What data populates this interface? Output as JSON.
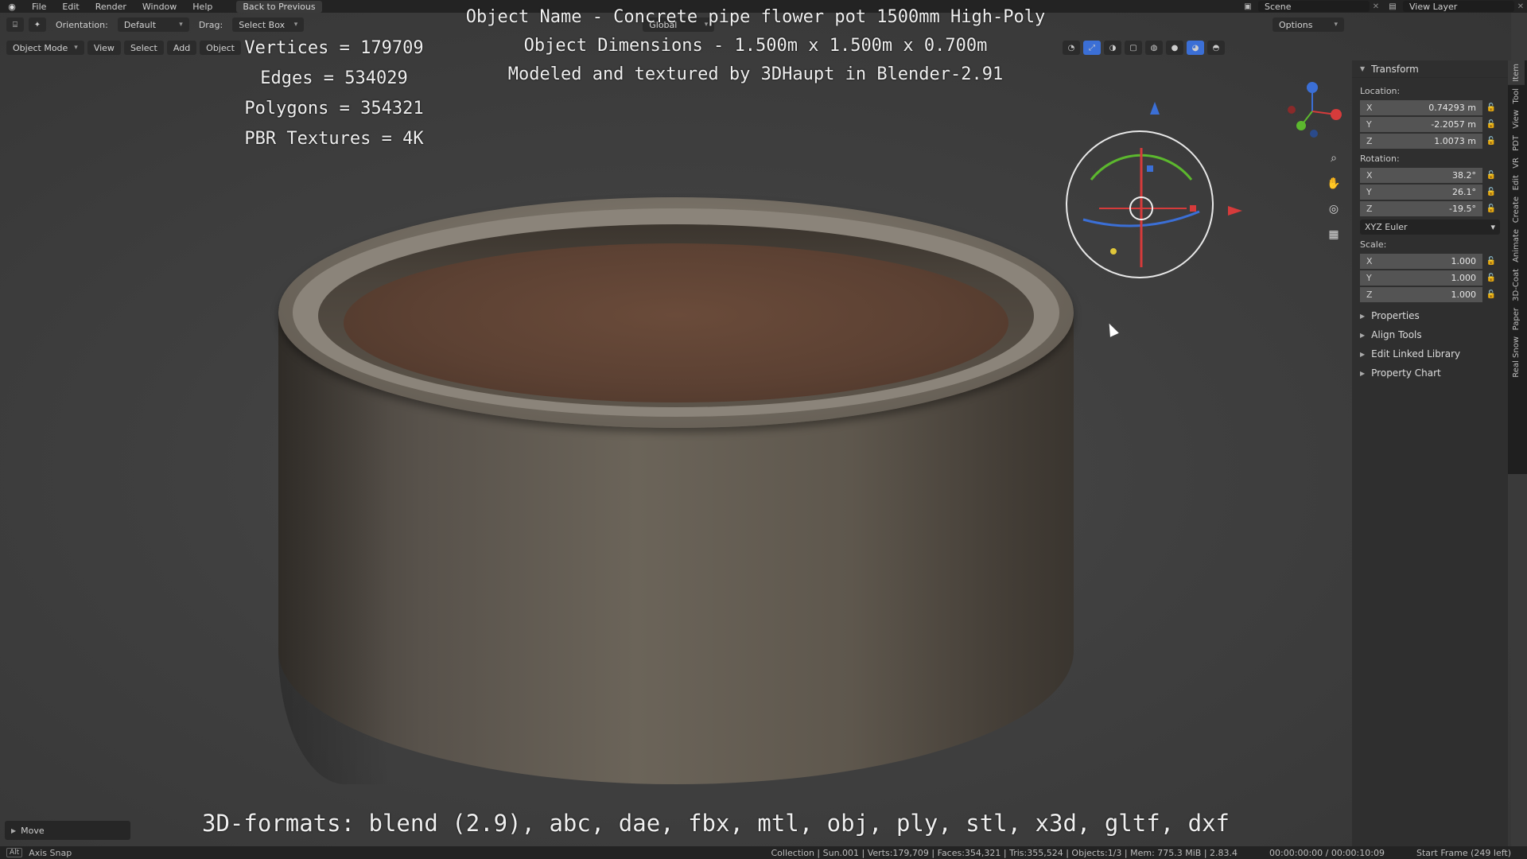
{
  "topbar": {
    "menus": [
      "File",
      "Edit",
      "Render",
      "Window",
      "Help"
    ],
    "back_label": "Back to Previous",
    "scene": "Scene",
    "view_layer": "View Layer"
  },
  "header1": {
    "orientation_label": "Orientation:",
    "orientation_value": "Default",
    "drag_label": "Drag:",
    "drag_value": "Select Box",
    "transform_space": "Global",
    "options_label": "Options"
  },
  "header2": {
    "mode": "Object Mode",
    "menus": [
      "View",
      "Select",
      "Add",
      "Object"
    ]
  },
  "overlay": {
    "stats": [
      "Vertices = 179709",
      "Edges = 534029",
      "Polygons = 354321",
      "PBR Textures = 4K"
    ],
    "title_lines": [
      "Object Name - Concrete pipe flower pot 1500mm High-Poly",
      "Object Dimensions -  1.500m x 1.500m x 0.700m",
      "Modeled and textured by 3DHaupt in Blender-2.91"
    ],
    "formats": "3D-formats: blend (2.9), abc, dae, fbx, mtl, obj, ply, stl, x3d, gltf, dxf"
  },
  "npanel": {
    "header": "Transform",
    "location_label": "Location:",
    "location": {
      "x": "0.74293 m",
      "y": "-2.2057 m",
      "z": "1.0073 m"
    },
    "rotation_label": "Rotation:",
    "rotation": {
      "x": "38.2°",
      "y": "26.1°",
      "z": "-19.5°"
    },
    "rotation_mode": "XYZ Euler",
    "scale_label": "Scale:",
    "scale": {
      "x": "1.000",
      "y": "1.000",
      "z": "1.000"
    },
    "sections": [
      "Properties",
      "Align Tools",
      "Edit Linked Library",
      "Property Chart"
    ],
    "tabs": [
      "Item",
      "Tool",
      "View",
      "PDT",
      "VR",
      "Edit",
      "Create",
      "Animate",
      "3D-Coat",
      "Paper",
      "Real Snow"
    ]
  },
  "last_op": "Move",
  "statusbar": {
    "hint": "Axis Snap",
    "info": "Collection | Sun.001 | Verts:179,709 | Faces:354,321 | Tris:355,524 | Objects:1/3 | Mem: 775.3 MiB | 2.83.4",
    "time": "00:00:00:00 / 00:00:10:09",
    "frame": "Start Frame (249 left)"
  },
  "colors": {
    "accent_blue": "#3b6fd6",
    "axis_red": "#d63b3b",
    "axis_green": "#5cb82e"
  }
}
